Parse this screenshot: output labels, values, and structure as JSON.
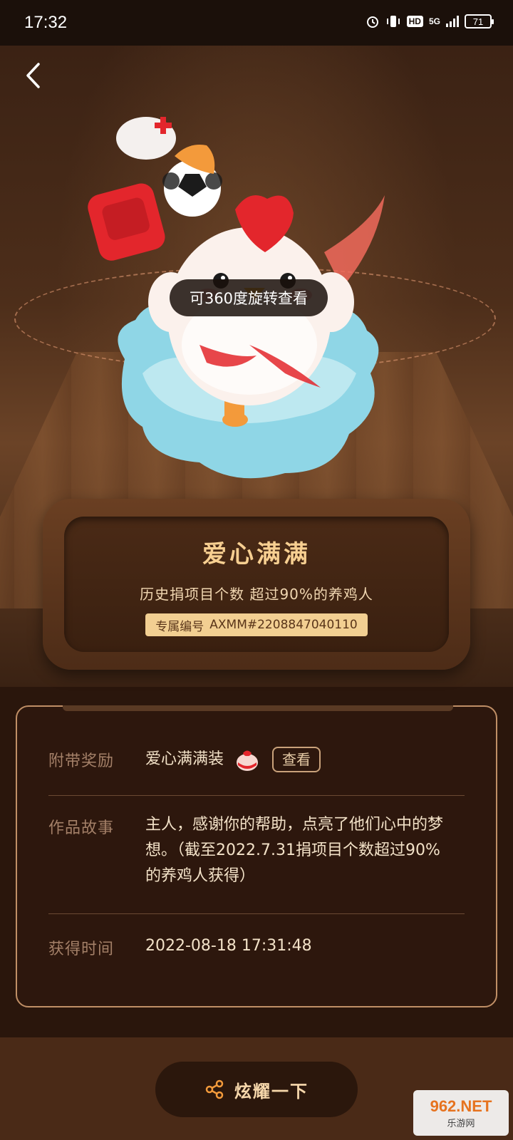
{
  "status_bar": {
    "time": "17:32",
    "network": "5G",
    "hd": "HD",
    "battery": "71"
  },
  "hero": {
    "rotate_hint": "可360度旋转查看"
  },
  "plaque": {
    "title": "爱心满满",
    "subtitle": "历史捐项目个数 超过90%的养鸡人",
    "serial_label": "专属编号",
    "serial_value": "AXMM#2208847040110"
  },
  "info": {
    "reward_label": "附带奖励",
    "reward_value": "爱心满满装",
    "reward_view_button": "查看",
    "story_label": "作品故事",
    "story_value": "主人，感谢你的帮助，点亮了他们心中的梦想。（截至2022.7.31捐项目个数超过90%的养鸡人获得）",
    "time_label": "获得时间",
    "time_value": "2022-08-18  17:31:48"
  },
  "share_button_label": "炫耀一下",
  "watermark": {
    "line1": "962.NET",
    "line2": "乐游网"
  },
  "colors": {
    "accent": "#f7cf91",
    "badge": "#f2cf92",
    "card_border": "#c08f66"
  }
}
